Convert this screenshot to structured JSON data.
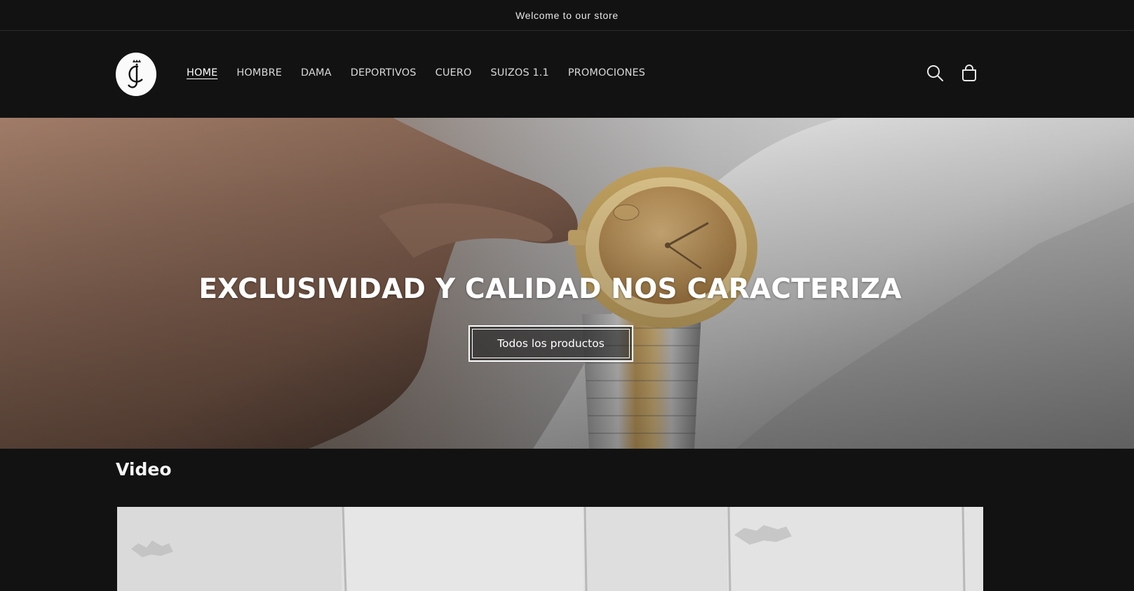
{
  "announcement": {
    "text": "Welcome to our store"
  },
  "header": {
    "logo_alt": "JC",
    "nav": [
      {
        "label": "HOME",
        "active": true
      },
      {
        "label": "HOMBRE"
      },
      {
        "label": "DAMA"
      },
      {
        "label": "DEPORTIVOS"
      },
      {
        "label": "CUERO"
      },
      {
        "label": "SUIZOS 1.1"
      },
      {
        "label": "PROMOCIONES"
      }
    ],
    "icons": [
      "search-icon",
      "cart-icon"
    ]
  },
  "hero": {
    "title": "EXCLUSIVIDAD Y CALIDAD NOS CARACTERIZA",
    "button_label": "Todos los productos"
  },
  "video": {
    "title": "Video"
  }
}
